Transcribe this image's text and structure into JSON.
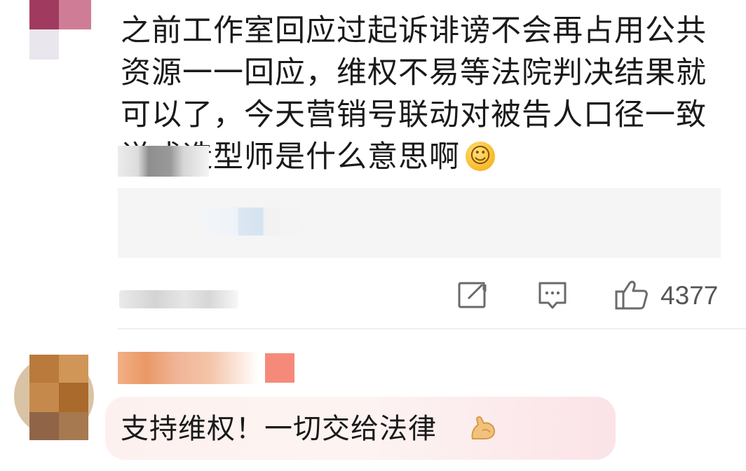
{
  "comment": {
    "text": "之前工作室回应过起诉诽谤不会再占用公共资源一一回应，维权不易等法院判决结果就可以了，今天营销号联动对被告人口径一致说成造型师是什么意思啊",
    "emoji": "smiling-face",
    "actions": {
      "share_icon": "share-icon",
      "reply_icon": "comment-icon",
      "like_icon": "thumbs-up-icon",
      "like_count": "4377"
    }
  },
  "reply": {
    "text": "支持维权！一切交给法律",
    "emoji": "flexed-biceps"
  },
  "colors": {
    "bubble": "#fdf1ef",
    "icon": "#666666",
    "like_count": "#555555"
  }
}
